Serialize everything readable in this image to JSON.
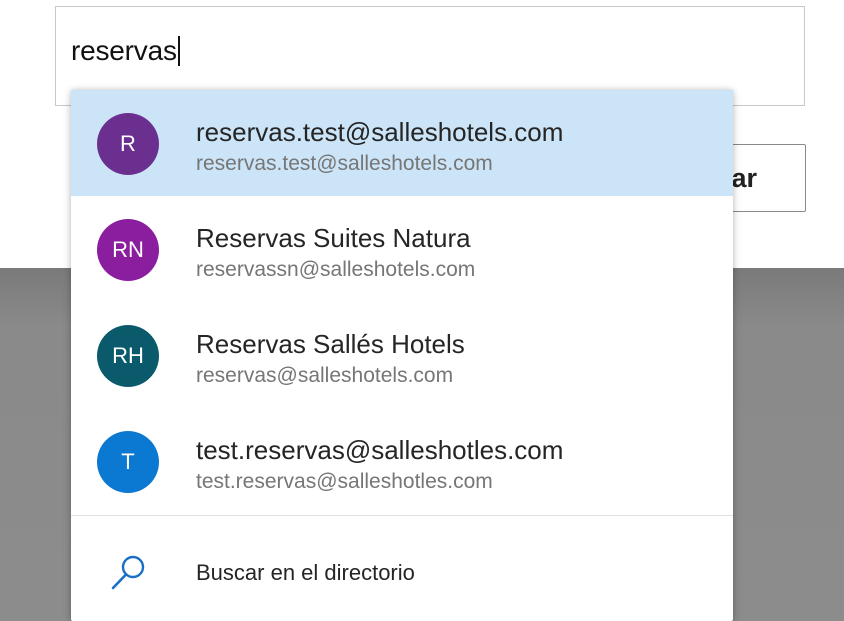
{
  "search": {
    "value": "reservas"
  },
  "background_button": {
    "label_partial": "ar"
  },
  "suggestions": [
    {
      "initials": "R",
      "name": "reservas.test@salleshotels.com",
      "email": "reservas.test@salleshotels.com",
      "color": "#6b2f8f",
      "selected": true
    },
    {
      "initials": "RN",
      "name": "Reservas Suites Natura",
      "email": "reservassn@salleshotels.com",
      "color": "#8b1e9e",
      "selected": false
    },
    {
      "initials": "RH",
      "name": "Reservas Sallés Hotels",
      "email": "reservas@salleshotels.com",
      "color": "#0b5a6b",
      "selected": false
    },
    {
      "initials": "T",
      "name": "test.reservas@salleshotles.com",
      "email": "test.reservas@salleshotles.com",
      "color": "#0b78d1",
      "selected": false
    }
  ],
  "directory_search": {
    "label": "Buscar en el directorio",
    "icon": "search-icon",
    "icon_color": "#1a6fc4"
  },
  "colors": {
    "selected_row": "#cce4f7",
    "overlay": "#8a8a8a"
  }
}
